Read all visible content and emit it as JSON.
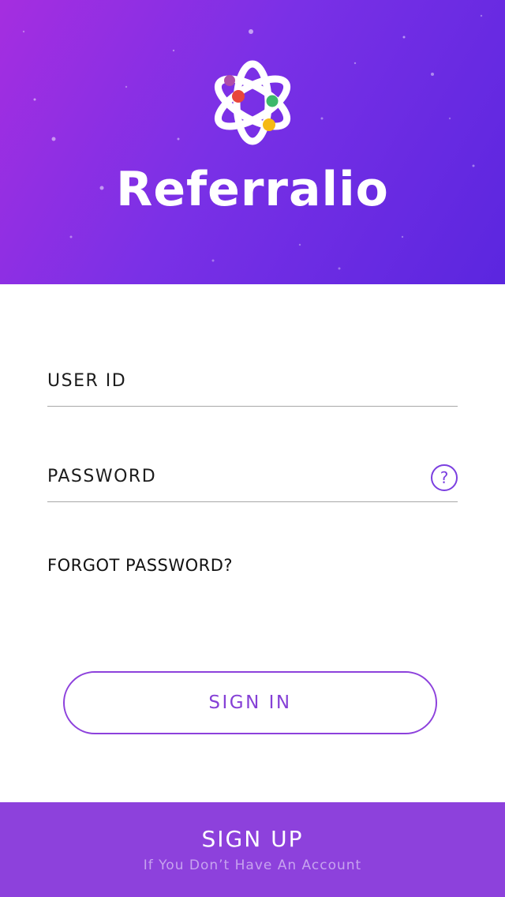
{
  "header": {
    "app_name": "Referralio",
    "logo_icon": "atom-orbit-logo-icon"
  },
  "form": {
    "user_id_label": "USER ID",
    "password_label": "PASSWORD",
    "help_symbol": "?",
    "forgot_password": "FORGOT PASSWORD?",
    "sign_in_label": "SIGN IN"
  },
  "footer": {
    "sign_up_label": "SIGN UP",
    "sign_up_subtitle": "If You Don’t Have An Account"
  },
  "colors": {
    "gradient_start": "#a52ee0",
    "gradient_end": "#5b26df",
    "accent": "#8d41dc",
    "logo_dot_red": "#e8463c",
    "logo_dot_green": "#3cb86a",
    "logo_dot_yellow": "#f5b914",
    "logo_dot_purple": "#b04ea8"
  }
}
